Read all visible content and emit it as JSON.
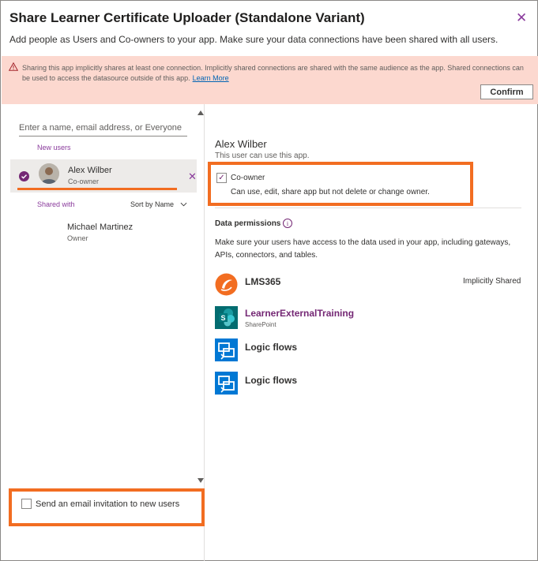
{
  "dialog": {
    "title": "Share Learner Certificate Uploader (Standalone Variant)",
    "subtitle": "Add people as Users and Co-owners to your app. Make sure your data connections have been shared with all users."
  },
  "warning": {
    "text": "Sharing this app implicitly shares at least one connection. Implicitly shared connections are shared with the same audience as the app. Shared connections can be used to access the datasource outside of this app.",
    "link": "Learn More",
    "confirm_label": "Confirm"
  },
  "left_panel": {
    "search_placeholder": "Enter a name, email address, or Everyone",
    "new_users_label": "New users",
    "new_user": {
      "name": "Alex Wilber",
      "role": "Co-owner",
      "selected": true
    },
    "shared_with_label": "Shared with",
    "sort_label": "Sort by Name",
    "shared_user": {
      "name": "Michael Martinez",
      "role": "Owner"
    },
    "email_invite_label": "Send an email invitation to new users",
    "email_invite_checked": false
  },
  "right_panel": {
    "user_name": "Alex Wilber",
    "can_use_text": "This user can use this app.",
    "coowner_label": "Co-owner",
    "coowner_checked": true,
    "coowner_desc": "Can use, edit, share app but not delete or change owner.",
    "data_permissions_title": "Data permissions",
    "data_permissions_desc": "Make sure your users have access to the data used in your app, including gateways, APIs, connectors, and tables.",
    "connections": [
      {
        "name": "LMS365",
        "subtitle": "",
        "status": "Implicitly Shared",
        "icon": "lms365-icon"
      },
      {
        "name": "LearnerExternalTraining",
        "subtitle": "SharePoint",
        "status": "",
        "icon": "sharepoint-icon"
      },
      {
        "name": "Logic flows",
        "subtitle": "",
        "status": "",
        "icon": "logic-flows-icon"
      },
      {
        "name": "Logic flows",
        "subtitle": "",
        "status": "",
        "icon": "logic-flows-icon"
      }
    ]
  },
  "colors": {
    "accent": "#742774",
    "highlight": "#f26d21",
    "warning_bg": "#fcd8cf",
    "lms365": "#f26d21",
    "sharepoint": "#036c70",
    "logic_flows": "#0078d4"
  }
}
